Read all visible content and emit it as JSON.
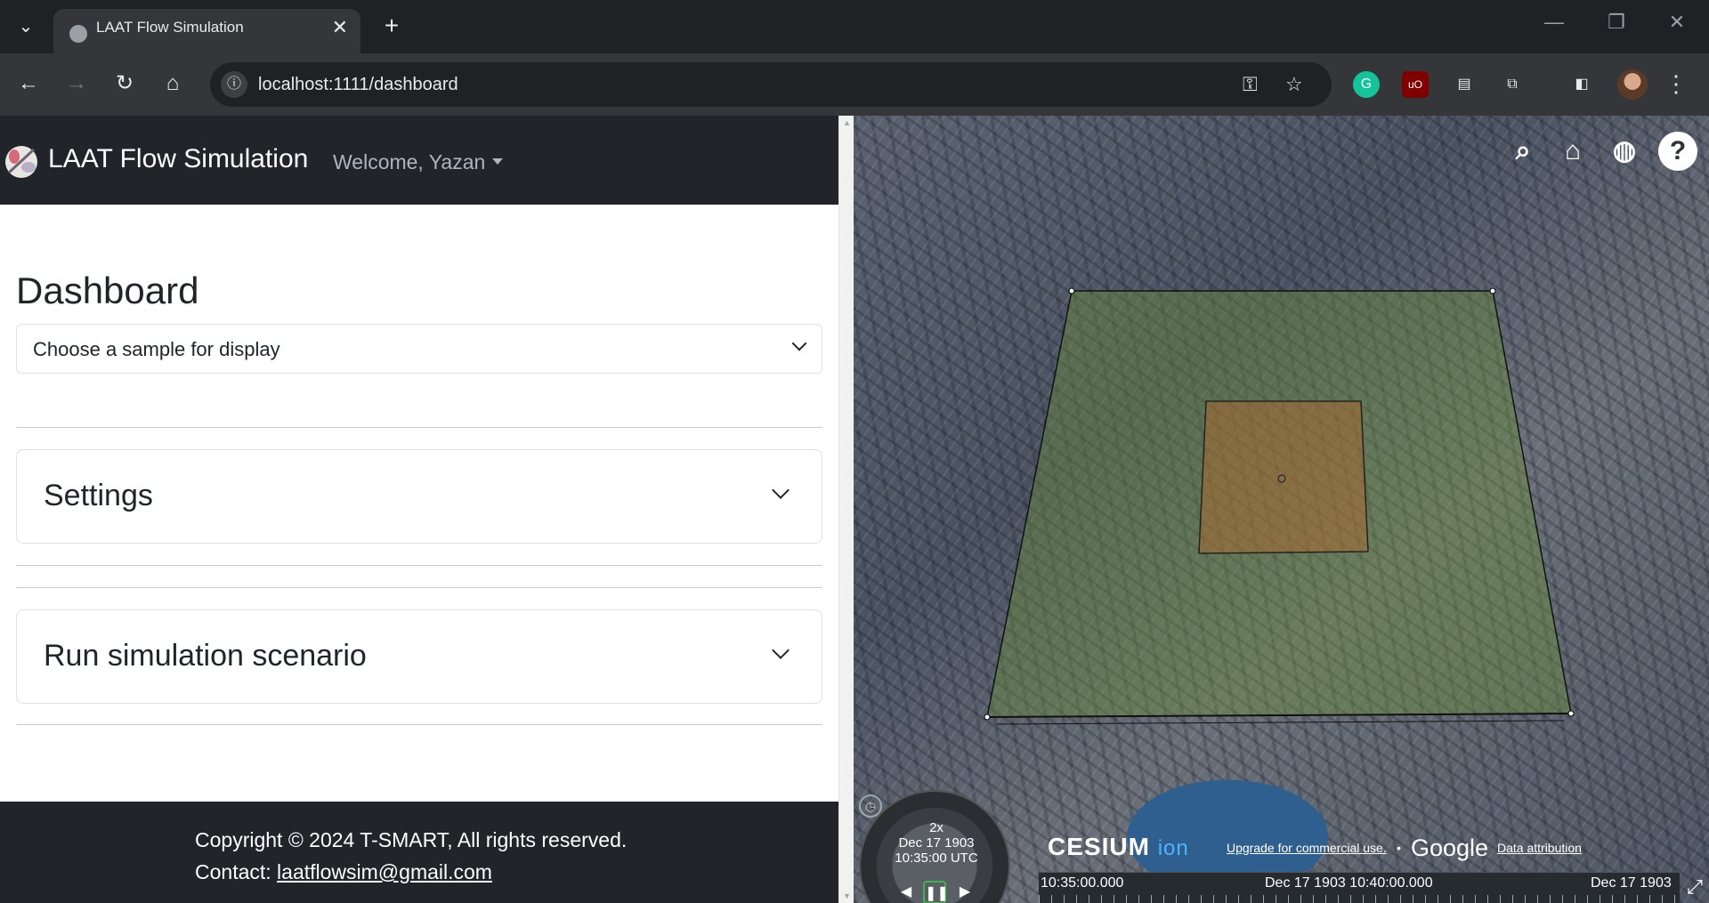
{
  "browser": {
    "tab_title": "LAAT Flow Simulation",
    "tab_close": "✕",
    "new_tab": "+",
    "url": "localhost:1111/dashboard",
    "icons": [
      "tab-list-icon",
      "back-icon",
      "forward-icon",
      "reload-icon",
      "home-icon",
      "site-info-icon",
      "password-key-icon",
      "bookmark-star-icon",
      "grammarly-icon",
      "ublock-icon",
      "reader-icon",
      "extensions-icon",
      "side-panel-icon",
      "profile-avatar",
      "menu-icon"
    ]
  },
  "app": {
    "brand": "LAAT Flow Simulation",
    "welcome": "Welcome, Yazan",
    "dashboard_title": "Dashboard",
    "sample_select": {
      "value": "Choose a sample for display"
    },
    "accordions": [
      {
        "title": "Settings"
      },
      {
        "title": "Run simulation scenario"
      }
    ],
    "footer": {
      "copyright": "Copyright © 2024 T-SMART, All rights reserved.",
      "contact_label": "Contact: ",
      "contact_email": "laatflowsim@gmail.com"
    }
  },
  "map": {
    "toolbar_icons": [
      "search-icon",
      "home-icon",
      "globe-icon",
      "help-icon"
    ],
    "help_label": "?",
    "animation": {
      "speed": "2x",
      "date": "Dec 17 1903",
      "time": "10:35:00 UTC"
    },
    "cesium_logo": "CESIUM",
    "cesium_ion": "ion",
    "upgrade_link": "Upgrade for commercial use.",
    "separator": "•",
    "google": "Google",
    "data_attribution": "Data attribution",
    "timeline": {
      "label_start": "10:35:00.000",
      "label_mid": "Dec 17 1903 10:40:00.000",
      "label_end": "Dec 17 1903"
    },
    "colors": {
      "outer_area": "#6b8f3a",
      "inner_area": "#b5652a"
    }
  }
}
